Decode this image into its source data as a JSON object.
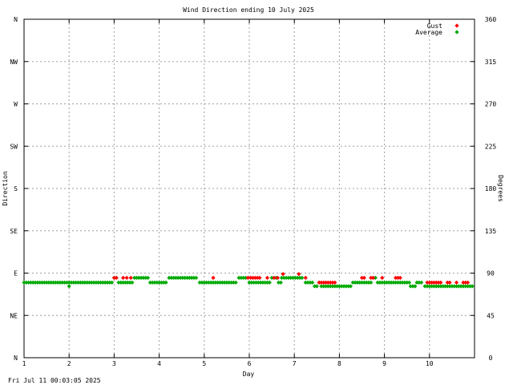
{
  "chart_data": {
    "type": "scatter",
    "title": "Wind Direction ending 10 July 2025",
    "xlabel": "Day",
    "ylabel_left": "Direction",
    "ylabel_right": "Degrees",
    "xlim": [
      1,
      11
    ],
    "ylim": [
      0,
      360
    ],
    "x_ticks": [
      1,
      2,
      3,
      4,
      5,
      6,
      7,
      8,
      9,
      10
    ],
    "x_tick_labels": [
      "1",
      "2",
      "3",
      "4",
      "5",
      "6",
      "7",
      "8",
      "9",
      "10"
    ],
    "y_ticks": [
      0,
      45,
      90,
      135,
      180,
      225,
      270,
      315,
      360
    ],
    "y_left_tick_labels": [
      "N",
      "NE",
      "E",
      "SE",
      "S",
      "SW",
      "W",
      "NW",
      "N"
    ],
    "y_right_tick_labels": [
      "0",
      "45",
      "90",
      "135",
      "180",
      "225",
      "270",
      "315",
      "360"
    ],
    "grid": true,
    "legend_position": "top-right",
    "series": [
      {
        "name": "Gust",
        "color": "#ff0000",
        "marker": "diamond",
        "points": [
          [
            3.0,
            85
          ],
          [
            3.05,
            85
          ],
          [
            3.2,
            85
          ],
          [
            3.28,
            85
          ],
          [
            3.37,
            85
          ],
          [
            5.2,
            85
          ],
          [
            5.97,
            85
          ],
          [
            6.03,
            85
          ],
          [
            6.08,
            85
          ],
          [
            6.13,
            85
          ],
          [
            6.18,
            85
          ],
          [
            6.23,
            85
          ],
          [
            6.4,
            85
          ],
          [
            6.55,
            85
          ],
          [
            6.63,
            85
          ],
          [
            6.75,
            89
          ],
          [
            7.1,
            89
          ],
          [
            7.25,
            85
          ],
          [
            7.55,
            80
          ],
          [
            7.6,
            80
          ],
          [
            7.65,
            80
          ],
          [
            7.7,
            80
          ],
          [
            7.75,
            80
          ],
          [
            7.8,
            80
          ],
          [
            7.85,
            80
          ],
          [
            7.9,
            80
          ],
          [
            8.5,
            85
          ],
          [
            8.55,
            85
          ],
          [
            8.7,
            85
          ],
          [
            8.75,
            85
          ],
          [
            8.95,
            85
          ],
          [
            9.25,
            85
          ],
          [
            9.3,
            85
          ],
          [
            9.35,
            85
          ],
          [
            9.95,
            80
          ],
          [
            10.0,
            80
          ],
          [
            10.05,
            80
          ],
          [
            10.1,
            80
          ],
          [
            10.15,
            80
          ],
          [
            10.2,
            80
          ],
          [
            10.25,
            80
          ],
          [
            10.4,
            80
          ],
          [
            10.45,
            80
          ],
          [
            10.6,
            80
          ],
          [
            10.75,
            80
          ],
          [
            10.8,
            80
          ],
          [
            10.85,
            80
          ]
        ]
      },
      {
        "name": "Average",
        "color": "#00aa00",
        "marker": "diamond",
        "segments": [
          {
            "x": [
              1.0,
              2.98
            ],
            "y": 80,
            "step": 0.05
          },
          {
            "x": [
              3.0,
              3.05
            ],
            "y": 85,
            "step": 0.05
          },
          {
            "x": [
              3.1,
              3.4
            ],
            "y": 80,
            "step": 0.05
          },
          {
            "x": [
              3.45,
              3.75
            ],
            "y": 85,
            "step": 0.05
          },
          {
            "x": [
              3.8,
              4.18
            ],
            "y": 80,
            "step": 0.05
          },
          {
            "x": [
              4.22,
              4.85
            ],
            "y": 85,
            "step": 0.05
          },
          {
            "x": [
              4.9,
              5.72
            ],
            "y": 80,
            "step": 0.05
          },
          {
            "x": [
              5.77,
              5.95
            ],
            "y": 85,
            "step": 0.05
          },
          {
            "x": [
              6.0,
              6.47
            ],
            "y": 80,
            "step": 0.05
          },
          {
            "x": [
              6.5,
              6.6
            ],
            "y": 85,
            "step": 0.05
          },
          {
            "x": [
              6.65,
              6.7
            ],
            "y": 80,
            "step": 0.05
          },
          {
            "x": [
              6.72,
              7.2
            ],
            "y": 85,
            "step": 0.05
          },
          {
            "x": [
              7.25,
              7.4
            ],
            "y": 80,
            "step": 0.05
          },
          {
            "x": [
              7.45,
              7.5
            ],
            "y": 76,
            "step": 0.05
          },
          {
            "x": [
              7.55,
              7.58
            ],
            "y": 80,
            "step": 0.05
          },
          {
            "x": [
              7.6,
              8.25
            ],
            "y": 76,
            "step": 0.05
          },
          {
            "x": [
              8.3,
              8.7
            ],
            "y": 80,
            "step": 0.05
          },
          {
            "x": [
              8.75,
              8.82
            ],
            "y": 85,
            "step": 0.05
          },
          {
            "x": [
              8.85,
              9.55
            ],
            "y": 80,
            "step": 0.05
          },
          {
            "x": [
              9.58,
              9.68
            ],
            "y": 76,
            "step": 0.05
          },
          {
            "x": [
              9.72,
              9.85
            ],
            "y": 80,
            "step": 0.05
          },
          {
            "x": [
              9.9,
              10.98
            ],
            "y": 76,
            "step": 0.05
          }
        ],
        "points": [
          [
            2.0,
            76
          ]
        ]
      }
    ]
  },
  "timestamp": "Fri Jul 11 00:03:05 2025"
}
